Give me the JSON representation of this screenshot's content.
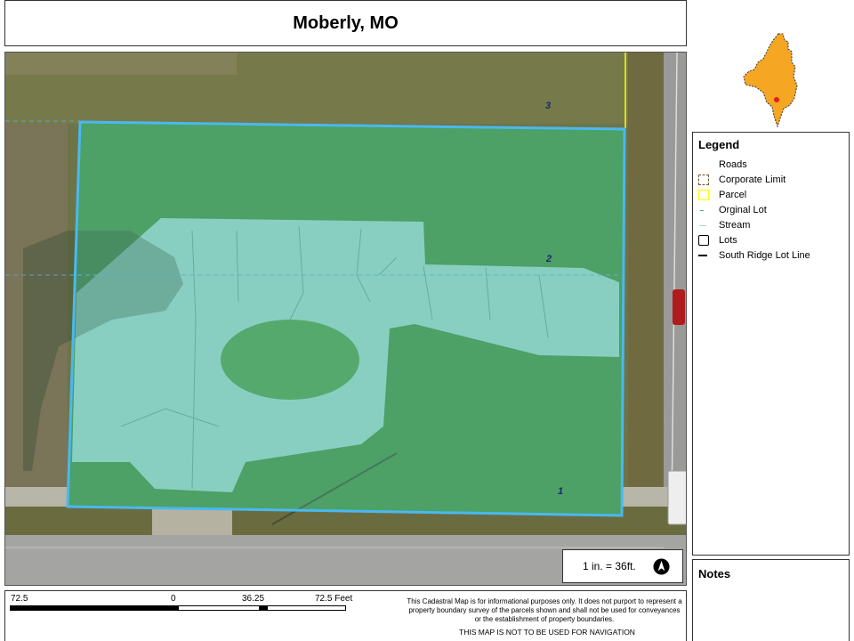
{
  "title": "Moberly, MO",
  "legend": {
    "heading": "Legend",
    "items": [
      {
        "label": "Roads",
        "symbol": "none"
      },
      {
        "label": "Corporate Limit",
        "symbol": "dashed-box",
        "color": "#6b5a2a"
      },
      {
        "label": "Parcel",
        "symbol": "box",
        "color": "#ffff00"
      },
      {
        "label": "Orginal Lot",
        "symbol": "dash-line",
        "color": "#5aa0d8"
      },
      {
        "label": "Stream",
        "symbol": "thin-line",
        "color": "#aad0ee"
      },
      {
        "label": "Lots",
        "symbol": "box",
        "color": "#000000"
      },
      {
        "label": "South Ridge Lot Line",
        "symbol": "line",
        "color": "#000000"
      }
    ]
  },
  "notes": {
    "heading": "Notes"
  },
  "scale": {
    "ratio_text": "1 in. = 36ft.",
    "labels": [
      "72.5",
      "0",
      "36.25",
      "72.5 Feet"
    ]
  },
  "disclaimer": "This Cadastral Map is for informational purposes only.  It does not purport to represent a property boundary survey of the parcels shown and shall not be used for conveyances or the establishment of property boundaries.",
  "nav_warning": "THIS MAP IS NOT TO BE USED FOR NAVIGATION",
  "parcels": [
    {
      "label": "1"
    },
    {
      "label": "2"
    },
    {
      "label": "3"
    }
  ],
  "colors": {
    "lot_outline": "#4ab8f0",
    "lot_fill": "#7fe0e0",
    "grass": "#3f8f45",
    "locator_fill": "#f5a623",
    "locator_marker": "#e02020"
  },
  "icons": {
    "north_arrow": "north-arrow-icon"
  }
}
